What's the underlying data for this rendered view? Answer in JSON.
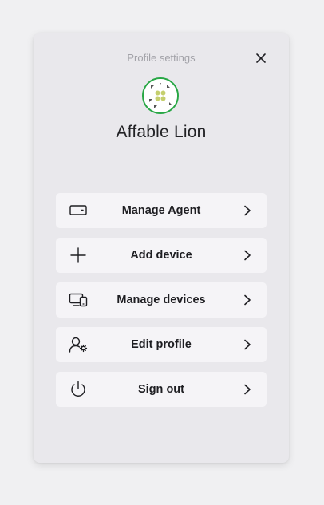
{
  "header": {
    "title": "Profile settings"
  },
  "profile": {
    "name": "Affable Lion"
  },
  "colors": {
    "avatar_ring": "#28a745",
    "avatar_dots": "#c5cf6e"
  },
  "menu": [
    {
      "label": "Manage Agent",
      "icon": "wallet-icon"
    },
    {
      "label": "Add device",
      "icon": "plus-icon"
    },
    {
      "label": "Manage devices",
      "icon": "devices-icon"
    },
    {
      "label": "Edit profile",
      "icon": "user-settings-icon"
    },
    {
      "label": "Sign out",
      "icon": "power-icon"
    }
  ]
}
